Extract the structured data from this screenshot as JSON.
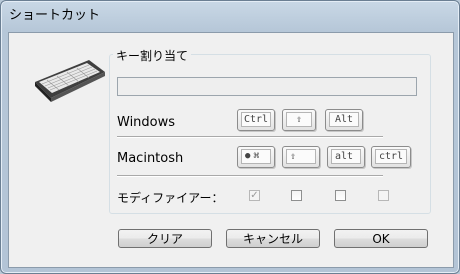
{
  "window": {
    "title": "ショートカット"
  },
  "group": {
    "label": "キー割り当て"
  },
  "key_field": {
    "value": ""
  },
  "rows": {
    "windows": {
      "label": "Windows",
      "keys": [
        "Ctrl",
        "⇧",
        "Alt"
      ]
    },
    "macintosh": {
      "label": "Macintosh",
      "keys": [
        "⌘",
        "⇧",
        "alt",
        "ctrl"
      ]
    },
    "modifier": {
      "label": "モディファイアー："
    }
  },
  "checkboxes": [
    {
      "checked": true,
      "disabled": true
    },
    {
      "checked": false,
      "disabled": false
    },
    {
      "checked": false,
      "disabled": false
    },
    {
      "checked": false,
      "disabled": true
    }
  ],
  "buttons": {
    "clear": "クリア",
    "cancel": "キャンセル",
    "ok": "OK"
  },
  "icons": {
    "keyboard": "keyboard-icon",
    "apple": "apple-icon",
    "command": "command-icon",
    "shift": "shift-icon"
  }
}
